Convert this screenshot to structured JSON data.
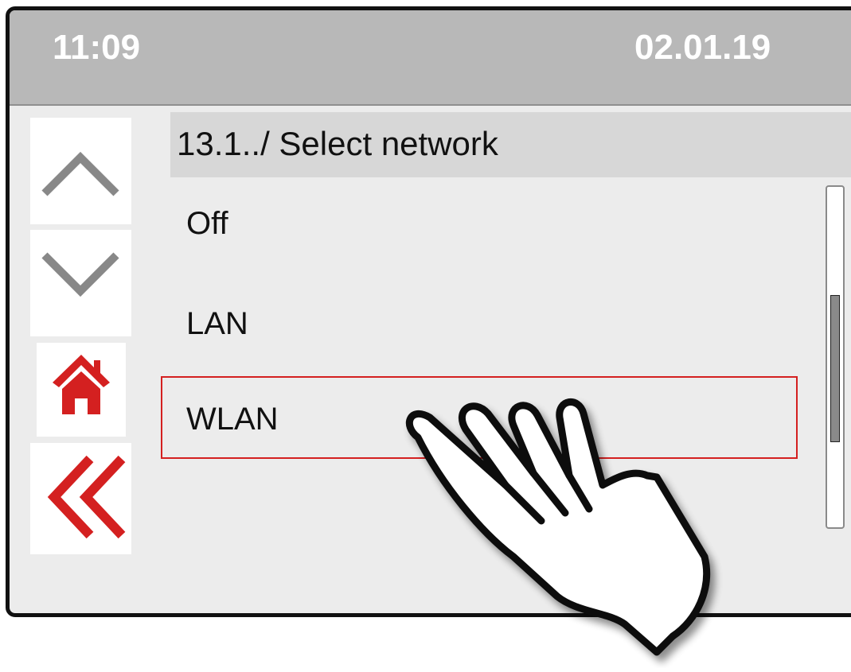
{
  "status": {
    "time": "11:09",
    "date": "02.01.19"
  },
  "menu": {
    "title": "13.1../  Select network",
    "items": [
      {
        "label": "Off"
      },
      {
        "label": "LAN"
      },
      {
        "label": "WLAN",
        "selected": true
      }
    ]
  },
  "scrollbar": {
    "position_fraction": 0.56,
    "visible_fraction": 0.44
  },
  "nav": {
    "up_icon": "chevron-up-icon",
    "down_icon": "chevron-down-icon",
    "home_icon": "home-icon",
    "back_icon": "double-chevron-left-icon"
  },
  "colors": {
    "status_bar": "#b8b8b8",
    "accent_red": "#d42020",
    "arrow_gray": "#888888",
    "background": "#ececec"
  }
}
